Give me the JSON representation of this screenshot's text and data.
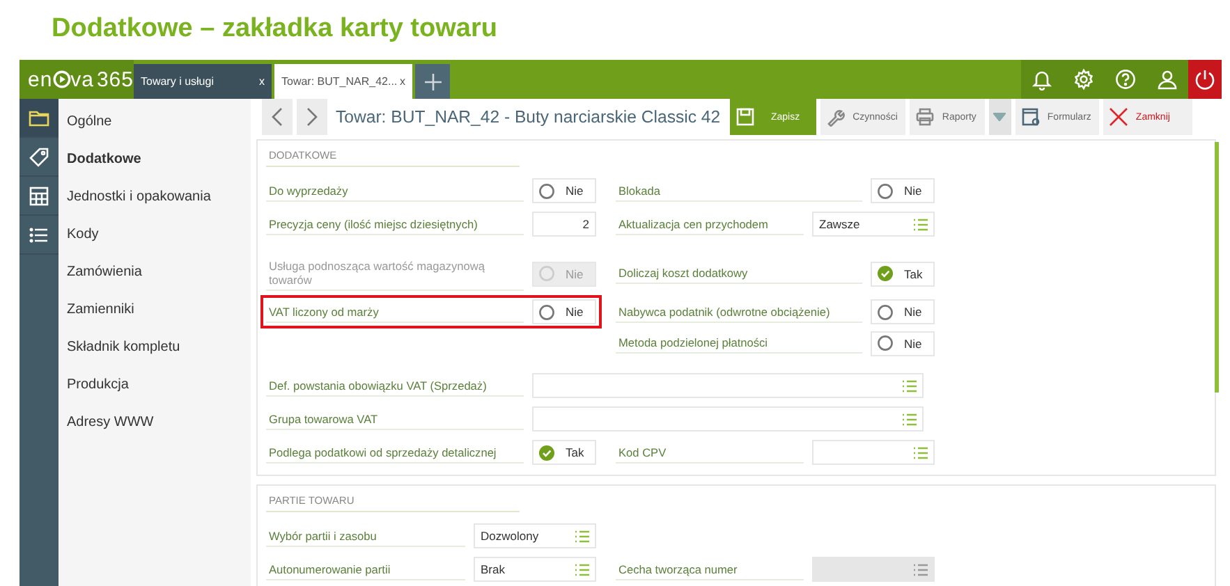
{
  "page_title": "Dodatkowe – zakładka karty towaru",
  "logo": {
    "prefix": "en",
    "suffix": "va",
    "number": "365"
  },
  "tabs": [
    {
      "label": "Towary i usługi",
      "close": "x",
      "selected": false
    },
    {
      "label": "Towar: BUT_NAR_42...",
      "close": "x",
      "selected": true
    }
  ],
  "sidebar": {
    "items": [
      {
        "label": "Ogólne",
        "selected": false
      },
      {
        "label": "Dodatkowe",
        "selected": true
      },
      {
        "label": "Jednostki i opakowania",
        "selected": false
      },
      {
        "label": "Kody",
        "selected": false
      },
      {
        "label": "Zamówienia",
        "selected": false
      },
      {
        "label": "Zamienniki",
        "selected": false
      },
      {
        "label": "Składnik kompletu",
        "selected": false
      },
      {
        "label": "Produkcja",
        "selected": false
      },
      {
        "label": "Adresy WWW",
        "selected": false
      }
    ]
  },
  "toolbar": {
    "title": "Towar: BUT_NAR_42 - Buty narciarskie Classic 42",
    "buttons": [
      {
        "kind": "save",
        "label": "Zapisz"
      },
      {
        "kind": "actions",
        "label": "Czynności"
      },
      {
        "kind": "reports",
        "label": "Raporty"
      },
      {
        "kind": "form",
        "label": "Formularz"
      },
      {
        "kind": "close",
        "label": "Zamknij"
      }
    ]
  },
  "sections": [
    {
      "title": "DODATKOWE",
      "rows": [
        {
          "kind": "pair",
          "highlighted": false,
          "left": {
            "label": "Do wyprzedaży",
            "field": {
              "kind": "toggle",
              "value": "Nie",
              "checked": false,
              "disabled": false
            }
          },
          "right": {
            "label": "Blokada",
            "field": {
              "kind": "toggle",
              "value": "Nie",
              "checked": false,
              "disabled": false
            }
          }
        },
        {
          "kind": "pair",
          "highlighted": false,
          "left": {
            "label": "Precyzja ceny (ilość miejsc dziesiętnych)",
            "field": {
              "kind": "number",
              "value": "2"
            }
          },
          "right": {
            "label": "Aktualizacja cen przychodem",
            "field": {
              "kind": "select",
              "value": "Zawsze",
              "disabled": false
            }
          }
        },
        {
          "kind": "pair",
          "highlighted": false,
          "left": {
            "label": "Usługa podnosząca wartość magazynową towarów",
            "field": {
              "kind": "toggle",
              "value": "Nie",
              "checked": false,
              "disabled": true
            }
          },
          "right": {
            "label": "Doliczaj koszt dodatkowy",
            "field": {
              "kind": "toggle",
              "value": "Tak",
              "checked": true,
              "disabled": false
            }
          }
        },
        {
          "kind": "pair",
          "highlighted": true,
          "left": {
            "label": "VAT liczony od marży",
            "field": {
              "kind": "toggle",
              "value": "Nie",
              "checked": false,
              "disabled": false
            }
          },
          "right": {
            "label": "Nabywca podatnik (odwrotne obciążenie)",
            "field": {
              "kind": "toggle",
              "value": "Nie",
              "checked": false,
              "disabled": false
            }
          }
        },
        {
          "kind": "pair",
          "highlighted": false,
          "right": {
            "label": "Metoda podzielonej płatności",
            "field": {
              "kind": "toggle",
              "value": "Nie",
              "checked": false,
              "disabled": false
            }
          }
        },
        {
          "kind": "wide",
          "highlighted": false,
          "left": {
            "label": "Def. powstania obowiązku VAT (Sprzedaż)",
            "field": {
              "kind": "select",
              "disabled": false
            }
          }
        },
        {
          "kind": "wide",
          "highlighted": false,
          "left": {
            "label": "Grupa towarowa VAT",
            "field": {
              "kind": "select",
              "disabled": false
            }
          }
        },
        {
          "kind": "pair",
          "highlighted": false,
          "left": {
            "label": "Podlega podatkowi od sprzedaży detalicznej",
            "field": {
              "kind": "toggle",
              "value": "Tak",
              "checked": true,
              "disabled": false
            }
          },
          "right": {
            "label": "Kod CPV",
            "field": {
              "kind": "select",
              "disabled": false
            }
          }
        }
      ]
    },
    {
      "title": "PARTIE TOWARU",
      "rows": [
        {
          "kind": "pair",
          "highlighted": false,
          "left": {
            "label": "Wybór partii i zasobu",
            "field": {
              "kind": "select",
              "value": "Dozwolony",
              "disabled": false
            }
          }
        },
        {
          "kind": "pair",
          "highlighted": false,
          "left": {
            "label": "Autonumerowanie partii",
            "field": {
              "kind": "select",
              "value": "Brak",
              "disabled": false
            }
          },
          "right": {
            "label": "Cecha tworząca numer",
            "field": {
              "kind": "select",
              "disabled": true
            }
          }
        }
      ]
    }
  ]
}
